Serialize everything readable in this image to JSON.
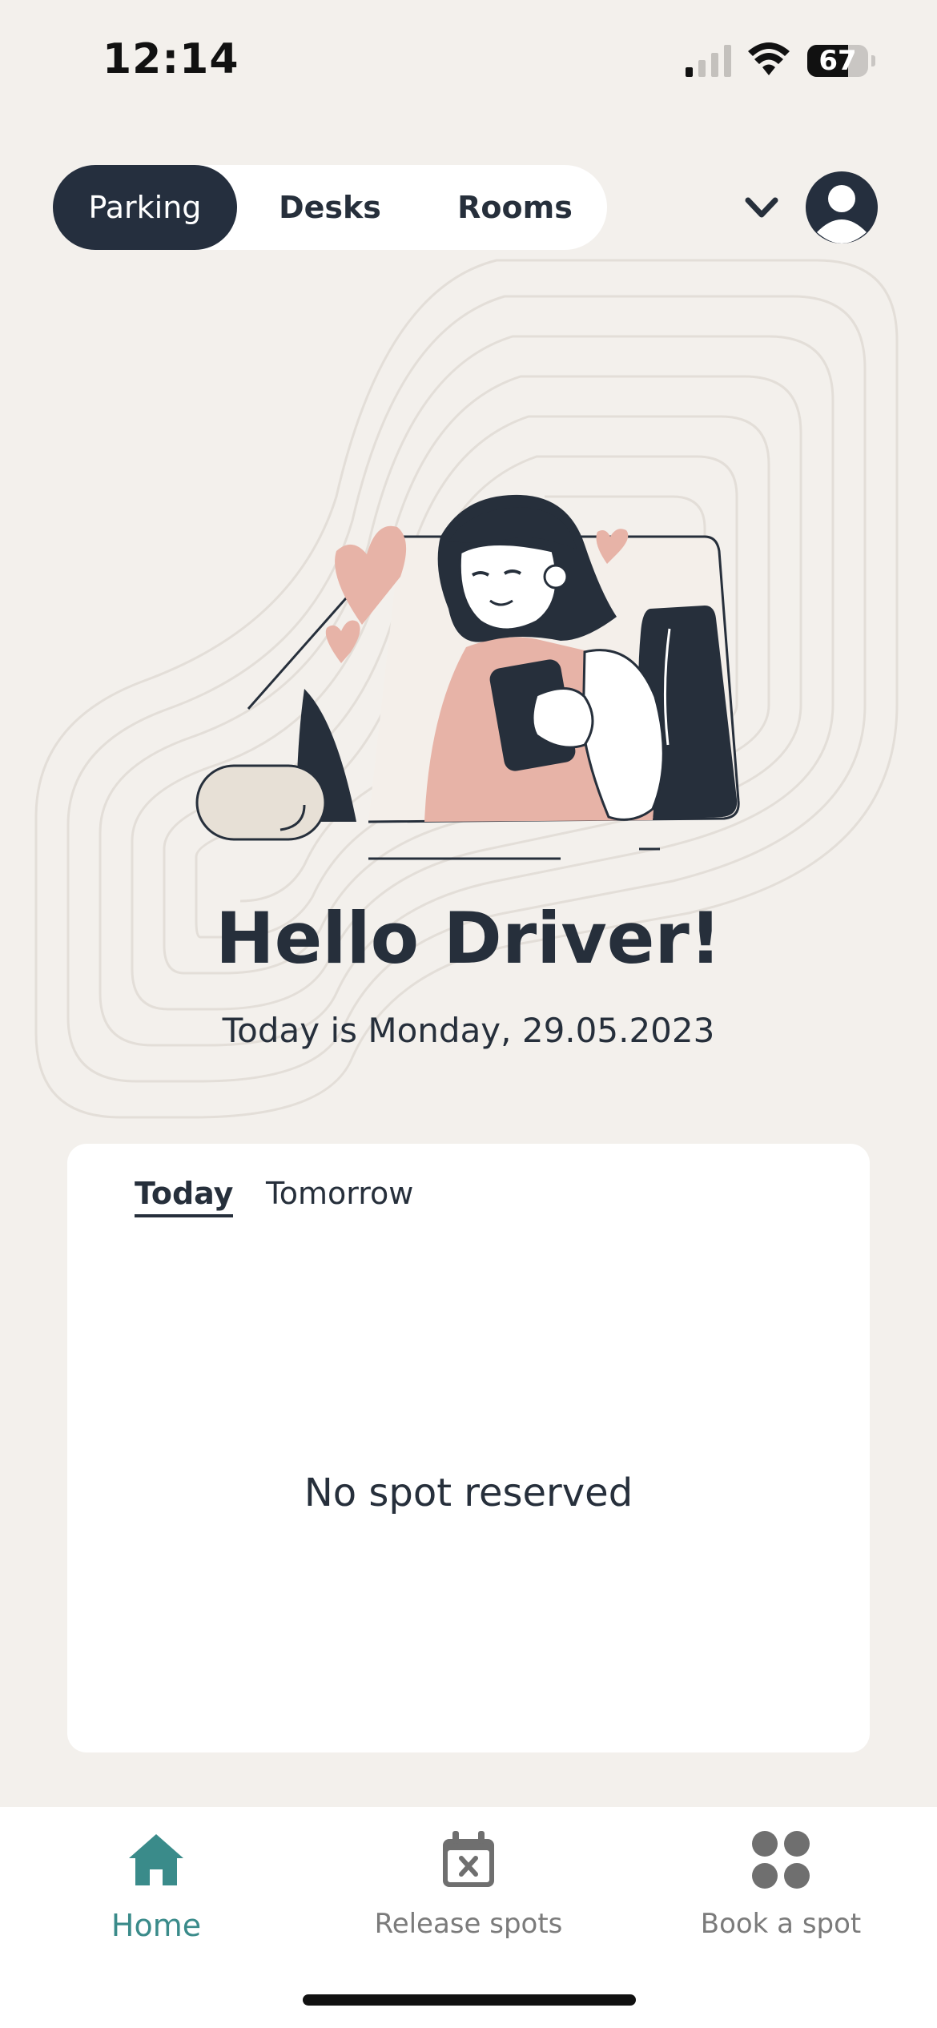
{
  "status_bar": {
    "time": "12:14",
    "battery": "67",
    "battery_percent": 67
  },
  "top_tabs": {
    "parking": "Parking",
    "desks": "Desks",
    "rooms": "Rooms",
    "selected": "Parking"
  },
  "hero": {
    "title": "Hello Driver!",
    "date_line": "Today is Monday, 29.05.2023"
  },
  "reservation_card": {
    "tab_today": "Today",
    "tab_tomorrow": "Tomorrow",
    "selected_tab": "Today",
    "empty_message": "No spot reserved"
  },
  "bottom_nav": {
    "home": "Home",
    "release": "Release spots",
    "book": "Book a spot",
    "active": "Home"
  },
  "colors": {
    "background": "#f3f0ec",
    "navy": "#252f3e",
    "accent_teal": "#3a8b8a",
    "pink": "#e8b4aa",
    "inactive_grey": "#7b7b7b"
  },
  "icons": [
    "signal-icon",
    "wifi-icon",
    "battery-icon",
    "chevron-down-icon",
    "user-icon",
    "home-icon",
    "calendar-x-icon",
    "grid-dots-icon"
  ]
}
